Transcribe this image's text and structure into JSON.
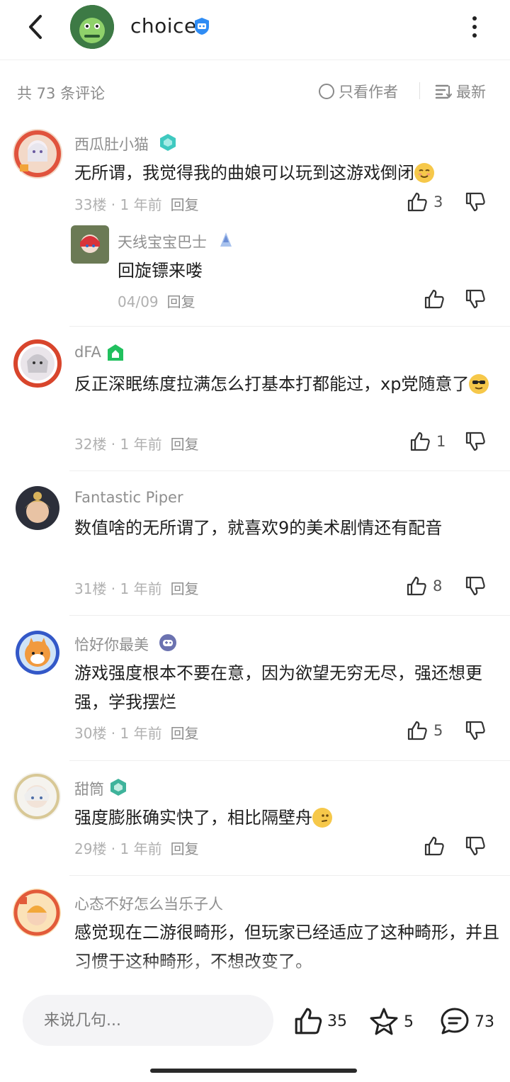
{
  "header": {
    "title": "choice"
  },
  "filter": {
    "total": "共 73 条评论",
    "author_only": "只看作者",
    "sort": "最新"
  },
  "comments": [
    {
      "user": "西瓜肚小猫",
      "text": "无所谓，我觉得我的曲娘可以玩到这游戏倒闭",
      "floor": "33楼 · 1 年前",
      "reply": "回复",
      "likes": "3"
    },
    {
      "user": "天线宝宝巴士",
      "text": "回旋镖来喽",
      "floor": "04/09",
      "reply": "回复",
      "likes": ""
    },
    {
      "user": "dFA",
      "text": "反正深眠练度拉满怎么打基本打都能过，xp党随意了",
      "floor": "32楼 · 1 年前",
      "reply": "回复",
      "likes": "1"
    },
    {
      "user": "Fantastic Piper",
      "text": "数值啥的无所谓了，就喜欢9的美术剧情还有配音",
      "floor": "31楼 · 1 年前",
      "reply": "回复",
      "likes": "8"
    },
    {
      "user": "恰好你最美",
      "text": "游戏强度根本不要在意，因为欲望无穷无尽，强还想更强，学我摆烂",
      "floor": "30楼 · 1 年前",
      "reply": "回复",
      "likes": "5"
    },
    {
      "user": "甜筒",
      "text": "强度膨胀确实快了，相比隔壁舟",
      "floor": "29楼 · 1 年前",
      "reply": "回复",
      "likes": ""
    },
    {
      "user": "心态不好怎么当乐子人",
      "text": "感觉现在二游很畸形，但玩家已经适应了这种畸形，并且习惯于这种畸形，不想改变了。",
      "floor": "",
      "reply": "",
      "likes": ""
    }
  ],
  "bottom": {
    "placeholder": "来说几句...",
    "likes": "35",
    "favorites": "5",
    "comments": "73"
  },
  "colors": {
    "accent_blue": "#2f8cf4",
    "badge_green": "#21c05e",
    "badge_teal": "#3fc9c0"
  }
}
